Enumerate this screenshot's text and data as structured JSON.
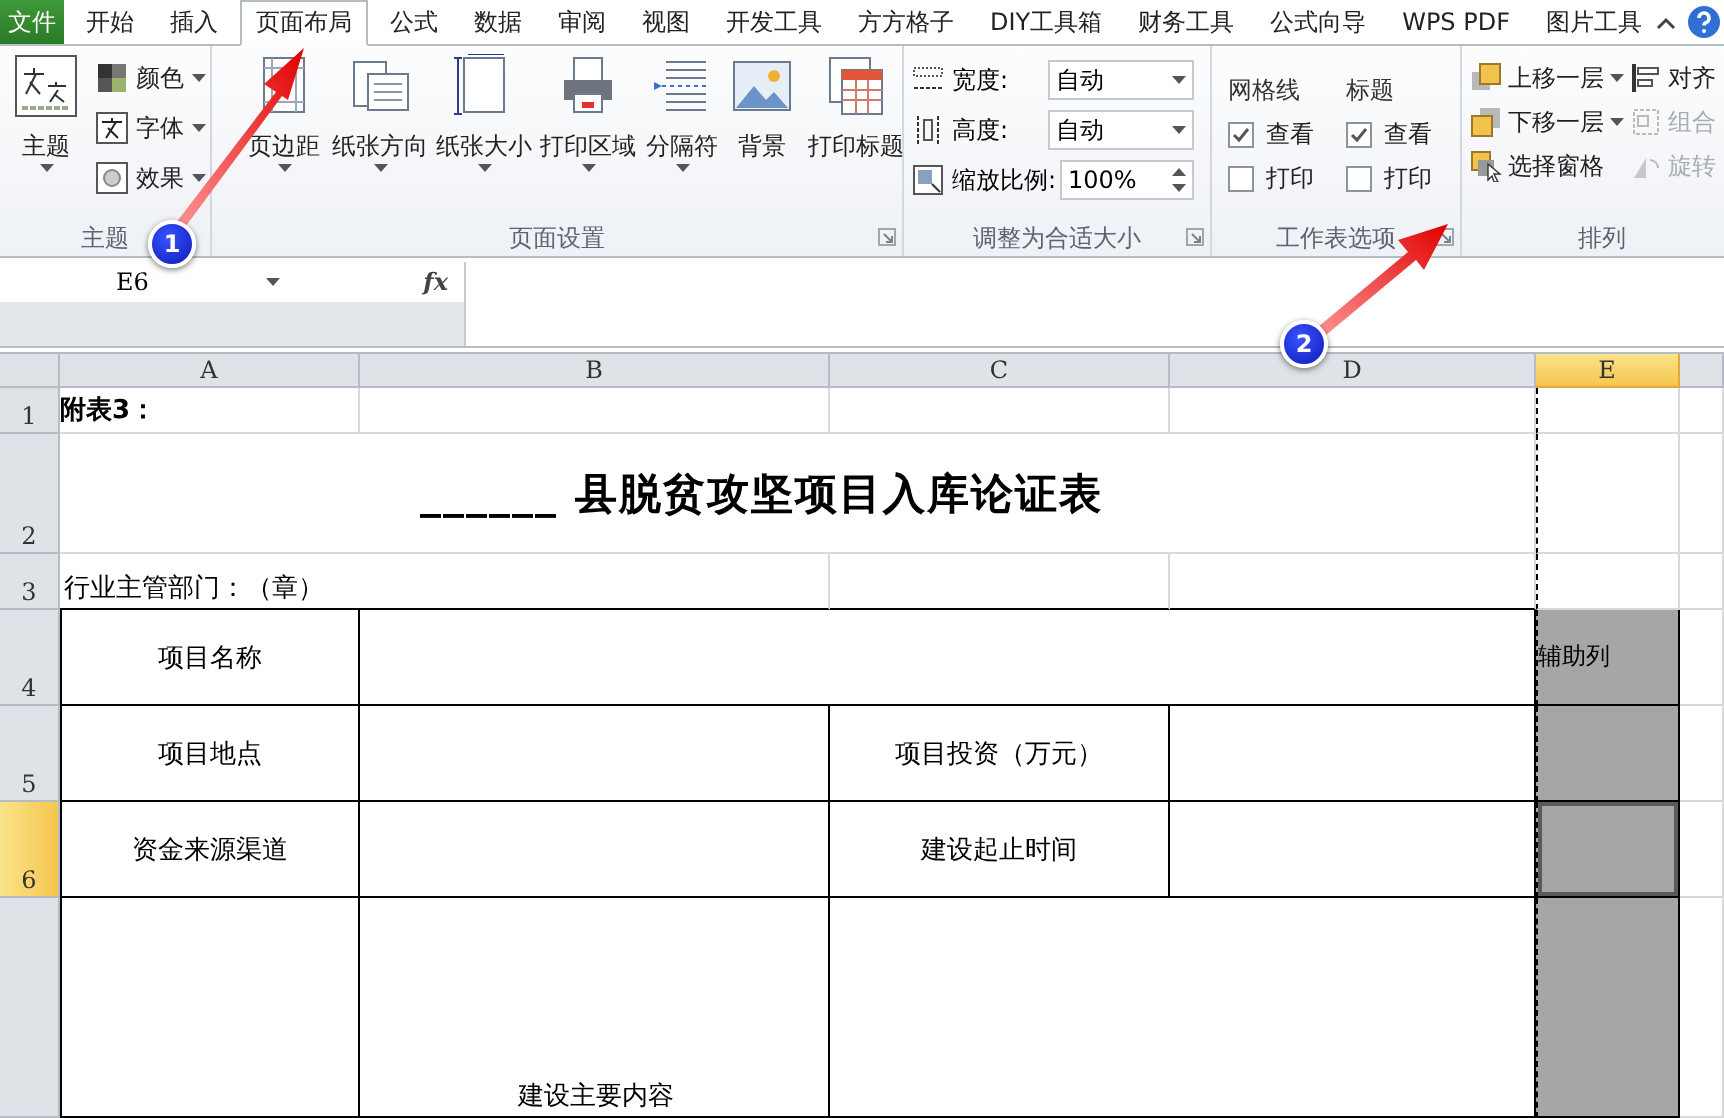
{
  "ribbon_tabs": [
    {
      "label": "文件",
      "kind": "file",
      "selected": false
    },
    {
      "label": "开始",
      "kind": "tab",
      "selected": false
    },
    {
      "label": "插入",
      "kind": "tab",
      "selected": false
    },
    {
      "label": "页面布局",
      "kind": "tab",
      "selected": true
    },
    {
      "label": "公式",
      "kind": "tab",
      "selected": false
    },
    {
      "label": "数据",
      "kind": "tab",
      "selected": false
    },
    {
      "label": "审阅",
      "kind": "tab",
      "selected": false
    },
    {
      "label": "视图",
      "kind": "tab",
      "selected": false
    },
    {
      "label": "开发工具",
      "kind": "tab",
      "selected": false
    },
    {
      "label": "方方格子",
      "kind": "tab",
      "selected": false
    },
    {
      "label": "DIY工具箱",
      "kind": "tab",
      "selected": false
    },
    {
      "label": "财务工具",
      "kind": "tab",
      "selected": false
    },
    {
      "label": "公式向导",
      "kind": "tab",
      "selected": false
    },
    {
      "label": "WPS PDF",
      "kind": "tab",
      "selected": false
    },
    {
      "label": "图片工具",
      "kind": "tab",
      "selected": false
    }
  ],
  "themes_group": {
    "title": "主题",
    "big_button": "主题",
    "small_buttons": [
      "颜色",
      "字体",
      "效果"
    ]
  },
  "page_setup_group": {
    "title": "页面设置",
    "buttons": [
      "页边距",
      "纸张方向",
      "纸张大小",
      "打印区域",
      "分隔符",
      "背景",
      "打印标题"
    ]
  },
  "scale_group": {
    "title": "调整为合适大小",
    "fields": [
      {
        "label": "宽度:",
        "value": "自动",
        "kind": "dropdown"
      },
      {
        "label": "高度:",
        "value": "自动",
        "kind": "dropdown"
      },
      {
        "label": "缩放比例:",
        "value": "100%",
        "kind": "spinner"
      }
    ]
  },
  "sheet_options_group": {
    "title": "工作表选项",
    "columns": [
      {
        "heading": "网格线",
        "options": [
          {
            "label": "查看",
            "checked": true
          },
          {
            "label": "打印",
            "checked": false
          }
        ]
      },
      {
        "heading": "标题",
        "options": [
          {
            "label": "查看",
            "checked": true
          },
          {
            "label": "打印",
            "checked": false
          }
        ]
      }
    ]
  },
  "arrange_group": {
    "title": "排列",
    "buttons": [
      {
        "label": "上移一层",
        "dropdown": true,
        "disabled": false
      },
      {
        "label": "下移一层",
        "dropdown": true,
        "disabled": false
      },
      {
        "label": "选择窗格",
        "dropdown": false,
        "disabled": false
      },
      {
        "label": "对齐",
        "dropdown": false,
        "disabled": false
      },
      {
        "label": "组合",
        "dropdown": false,
        "disabled": true
      },
      {
        "label": "旋转",
        "dropdown": false,
        "disabled": true
      }
    ]
  },
  "formula_bar": {
    "name_box": "E6",
    "function_label": "fx"
  },
  "sheet": {
    "columns": [
      {
        "label": "A",
        "selected": false
      },
      {
        "label": "B",
        "selected": false
      },
      {
        "label": "C",
        "selected": false
      },
      {
        "label": "D",
        "selected": false
      },
      {
        "label": "E",
        "selected": true
      }
    ],
    "rows": [
      {
        "label": "1",
        "selected": false,
        "cells": [
          "附表3："
        ]
      },
      {
        "label": "2",
        "selected": false,
        "cells": [
          "",
          "______  县脱贫攻坚项目入库论证表"
        ]
      },
      {
        "label": "3",
        "selected": false,
        "cells": [
          "行业主管部门：（章）"
        ]
      },
      {
        "label": "4",
        "selected": false,
        "cells": [
          "项目名称",
          "",
          "",
          "",
          "辅助列"
        ]
      },
      {
        "label": "5",
        "selected": false,
        "cells": [
          "项目地点",
          "",
          "项目投资（万元）"
        ]
      },
      {
        "label": "6",
        "selected": true,
        "cells": [
          "资金来源渠道",
          "",
          "建设起止时间"
        ]
      },
      {
        "cells": [
          "",
          "建设主要内容"
        ]
      }
    ]
  },
  "annotations": [
    {
      "number": "1"
    },
    {
      "number": "2"
    }
  ]
}
